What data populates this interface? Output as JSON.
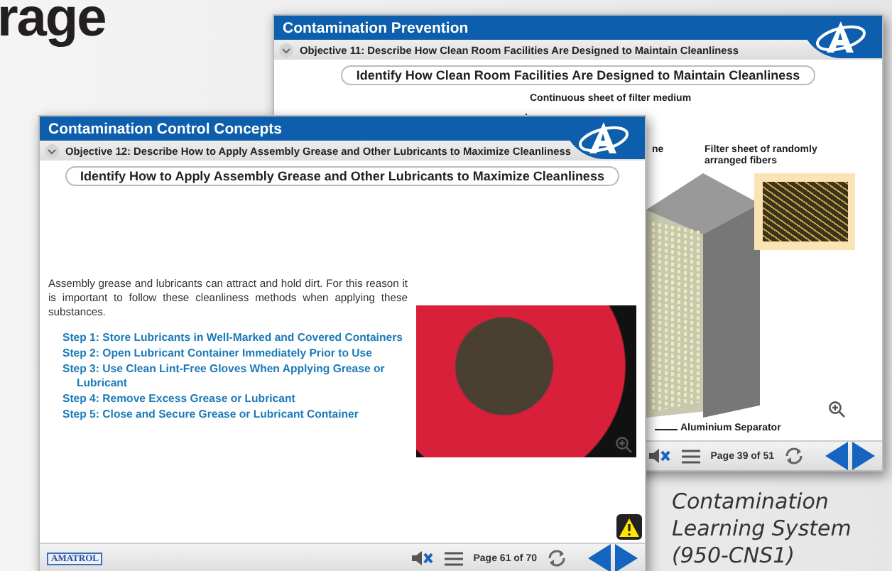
{
  "heading": "rage",
  "windows": [
    {
      "kind": "diagram",
      "title": "Contamination Prevention",
      "objective": "Objective 11: Describe How Clean Room Facilities Are Designed to Maintain Cleanliness",
      "lesson_title": "Identify How Clean Room Facilities Are Designed to Maintain Cleanliness",
      "labels": [
        "Continuous sheet of filter medium",
        "ne",
        "Filter sheet of randomly arranged fibers",
        "Aluminium Separator"
      ],
      "page": "Page 39 of 51"
    },
    {
      "kind": "text",
      "title": "Contamination Control Concepts",
      "objective": "Objective 12: Describe How to Apply Assembly Grease and Other Lubricants to Maximize Cleanliness",
      "lesson_title": "Identify How to Apply Assembly Grease and Other Lubricants to Maximize Cleanliness",
      "paragraph": "Assembly grease and lubricants can attract and hold dirt. For this reason it is important to follow these cleanliness methods when applying these substances.",
      "steps": [
        "Step 1: Store Lubricants in Well-Marked and Covered Containers",
        "Step 2: Open Lubricant Container Immediately Prior to Use",
        "Step 3: Use Clean Lint-Free Gloves When Applying Grease or Lubricant",
        "Step 4: Remove Excess Grease or Lubricant",
        "Step 5: Close and Secure Grease or Lubricant Container"
      ],
      "brand": "AMATROL",
      "page": "Page 61 of 70"
    }
  ],
  "caption": [
    "Contamination",
    "Learning System",
    "(950-CNS1)"
  ]
}
